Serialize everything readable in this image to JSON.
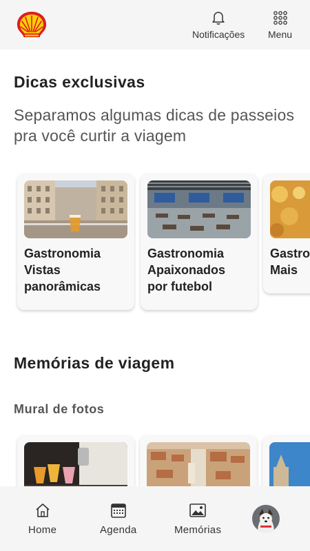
{
  "header": {
    "logo_icon": "shell-pecten-logo",
    "notifications_label": "Notificações",
    "menu_label": "Menu"
  },
  "tips": {
    "title": "Dicas exclusivas",
    "subtitle": "Separamos algumas dicas de passeios pra você curtir a viagem",
    "cards": [
      {
        "line1": "Gastronomia",
        "line2": "Vistas",
        "line3": "panorâmicas"
      },
      {
        "line1": "Gastronomia",
        "line2": "Apaixonados",
        "line3": "por futebol"
      },
      {
        "line1": "Gastronomia",
        "line2": "Mais",
        "line3": ""
      }
    ]
  },
  "memories": {
    "title": "Memórias de viagem",
    "mural_title": "Mural de fotos"
  },
  "bottom_nav": {
    "home_label": "Home",
    "agenda_label": "Agenda",
    "memories_label": "Memórias",
    "profile_icon": "profile-avatar"
  },
  "colors": {
    "brand_yellow": "#FBCE07",
    "brand_red": "#DD1D21",
    "bar_background": "#f5f5f5"
  }
}
